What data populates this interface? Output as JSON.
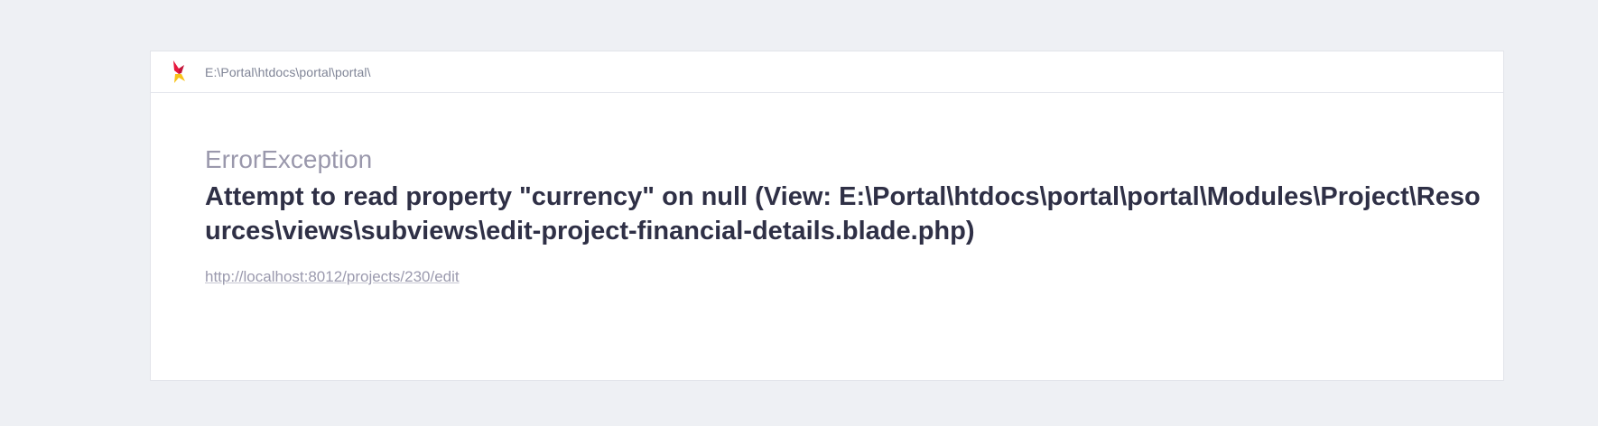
{
  "header": {
    "logo_icon": "ignition-flame-logo-icon",
    "path": "E:\\Portal\\htdocs\\portal\\portal\\"
  },
  "error": {
    "exception_class": "ErrorException",
    "message": "Attempt to read property \"currency\" on null (View: E:\\Portal\\htdocs\\portal\\portal\\Modules\\Project\\Resources\\views\\subviews\\edit-project-financial-details.blade.php)",
    "url": "http://localhost:8012/projects/230/edit"
  },
  "colors": {
    "background": "#eef0f4",
    "card": "#ffffff",
    "logo_red": "#e7173e",
    "logo_yellow": "#f8c31a"
  }
}
